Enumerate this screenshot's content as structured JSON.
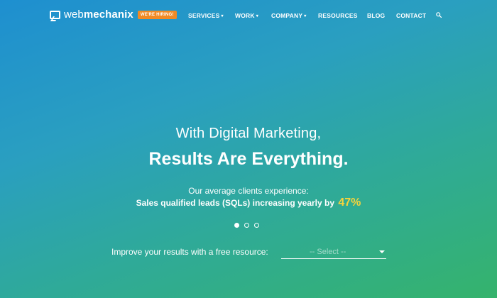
{
  "header": {
    "logo_light": "web",
    "logo_bold": "mechanix",
    "hiring_badge": "WE'RE HIRING!",
    "nav": [
      {
        "label": "SERVICES",
        "has_dropdown": true
      },
      {
        "label": "WORK",
        "has_dropdown": true
      },
      {
        "label": "COMPANY",
        "has_dropdown": true
      },
      {
        "label": "RESOURCES",
        "has_dropdown": false
      },
      {
        "label": "BLOG",
        "has_dropdown": false
      },
      {
        "label": "CONTACT",
        "has_dropdown": false
      }
    ],
    "caret": "▾",
    "search_icon": "search-icon"
  },
  "hero": {
    "line1": "With Digital Marketing,",
    "line2": "Results Are Everything.",
    "sub1": "Our average clients experience:",
    "sub2": "Sales qualified leads (SQLs) increasing yearly by",
    "stat": "47%",
    "stat_color": "#f5d33c"
  },
  "carousel": {
    "slide_count": 3,
    "active_index": 0
  },
  "resource": {
    "label": "Improve your results with a free resource:",
    "select_value": "-- Select --"
  },
  "colors": {
    "gradient_start": "#1e8fd0",
    "gradient_end": "#35b36c",
    "badge": "#f08a24"
  }
}
